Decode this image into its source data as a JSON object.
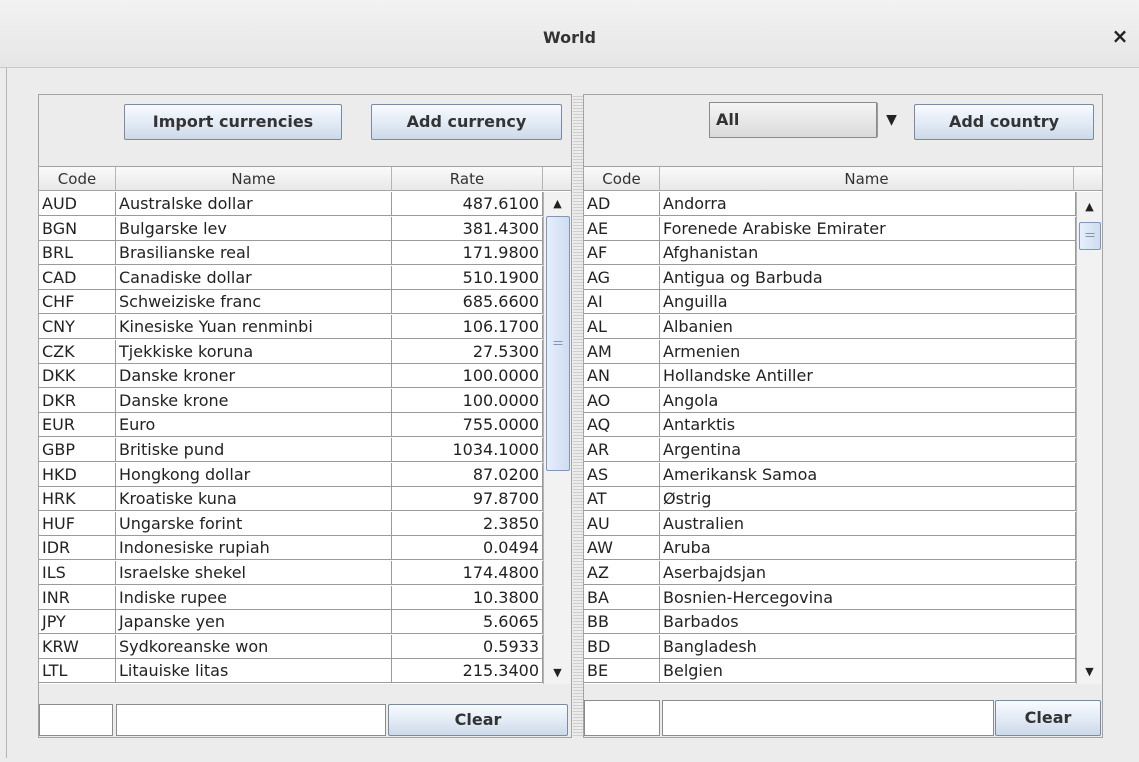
{
  "window": {
    "title": "World",
    "close_glyph": "×"
  },
  "currency_panel": {
    "import_label": "Import currencies",
    "add_label": "Add currency",
    "columns": [
      "Code",
      "Name",
      "Rate"
    ],
    "rows": [
      {
        "code": "AUD",
        "name": "Australske dollar",
        "rate": "487.6100"
      },
      {
        "code": "BGN",
        "name": "Bulgarske lev",
        "rate": "381.4300"
      },
      {
        "code": "BRL",
        "name": "Brasilianske real",
        "rate": "171.9800"
      },
      {
        "code": "CAD",
        "name": "Canadiske dollar",
        "rate": "510.1900"
      },
      {
        "code": "CHF",
        "name": "Schweiziske franc",
        "rate": "685.6600"
      },
      {
        "code": "CNY",
        "name": "Kinesiske Yuan renminbi",
        "rate": "106.1700"
      },
      {
        "code": "CZK",
        "name": "Tjekkiske koruna",
        "rate": "27.5300"
      },
      {
        "code": "DKK",
        "name": "Danske kroner",
        "rate": "100.0000"
      },
      {
        "code": "DKR",
        "name": "Danske krone",
        "rate": "100.0000"
      },
      {
        "code": "EUR",
        "name": "Euro",
        "rate": "755.0000"
      },
      {
        "code": "GBP",
        "name": "Britiske pund",
        "rate": "1034.1000"
      },
      {
        "code": "HKD",
        "name": "Hongkong dollar",
        "rate": "87.0200"
      },
      {
        "code": "HRK",
        "name": "Kroatiske kuna",
        "rate": "97.8700"
      },
      {
        "code": "HUF",
        "name": "Ungarske forint",
        "rate": "2.3850"
      },
      {
        "code": "IDR",
        "name": "Indonesiske rupiah",
        "rate": "0.0494"
      },
      {
        "code": "ILS",
        "name": "Israelske shekel",
        "rate": "174.4800"
      },
      {
        "code": "INR",
        "name": "Indiske rupee",
        "rate": "10.3800"
      },
      {
        "code": "JPY",
        "name": "Japanske yen",
        "rate": "5.6065"
      },
      {
        "code": "KRW",
        "name": "Sydkoreanske won",
        "rate": "0.5933"
      },
      {
        "code": "LTL",
        "name": "Litauiske litas",
        "rate": "215.3400"
      }
    ],
    "filter_code": "",
    "filter_name": "",
    "clear_label": "Clear"
  },
  "country_panel": {
    "continent_selected": "All",
    "add_label": "Add country",
    "columns": [
      "Code",
      "Name"
    ],
    "rows": [
      {
        "code": "AD",
        "name": "Andorra"
      },
      {
        "code": "AE",
        "name": "Forenede Arabiske Emirater"
      },
      {
        "code": "AF",
        "name": "Afghanistan"
      },
      {
        "code": "AG",
        "name": "Antigua og Barbuda"
      },
      {
        "code": "AI",
        "name": "Anguilla"
      },
      {
        "code": "AL",
        "name": "Albanien"
      },
      {
        "code": "AM",
        "name": "Armenien"
      },
      {
        "code": "AN",
        "name": "Hollandske Antiller"
      },
      {
        "code": "AO",
        "name": "Angola"
      },
      {
        "code": "AQ",
        "name": "Antarktis"
      },
      {
        "code": "AR",
        "name": "Argentina"
      },
      {
        "code": "AS",
        "name": "Amerikansk Samoa"
      },
      {
        "code": "AT",
        "name": "Østrig"
      },
      {
        "code": "AU",
        "name": "Australien"
      },
      {
        "code": "AW",
        "name": "Aruba"
      },
      {
        "code": "AZ",
        "name": "Aserbajdsjan"
      },
      {
        "code": "BA",
        "name": "Bosnien-Hercegovina"
      },
      {
        "code": "BB",
        "name": "Barbados"
      },
      {
        "code": "BD",
        "name": "Bangladesh"
      },
      {
        "code": "BE",
        "name": "Belgien"
      }
    ],
    "filter_code": "",
    "filter_name": "",
    "clear_label": "Clear"
  },
  "icons": {
    "scroll_up": "▲",
    "scroll_down": "▼",
    "combo_arrow": "▼"
  }
}
